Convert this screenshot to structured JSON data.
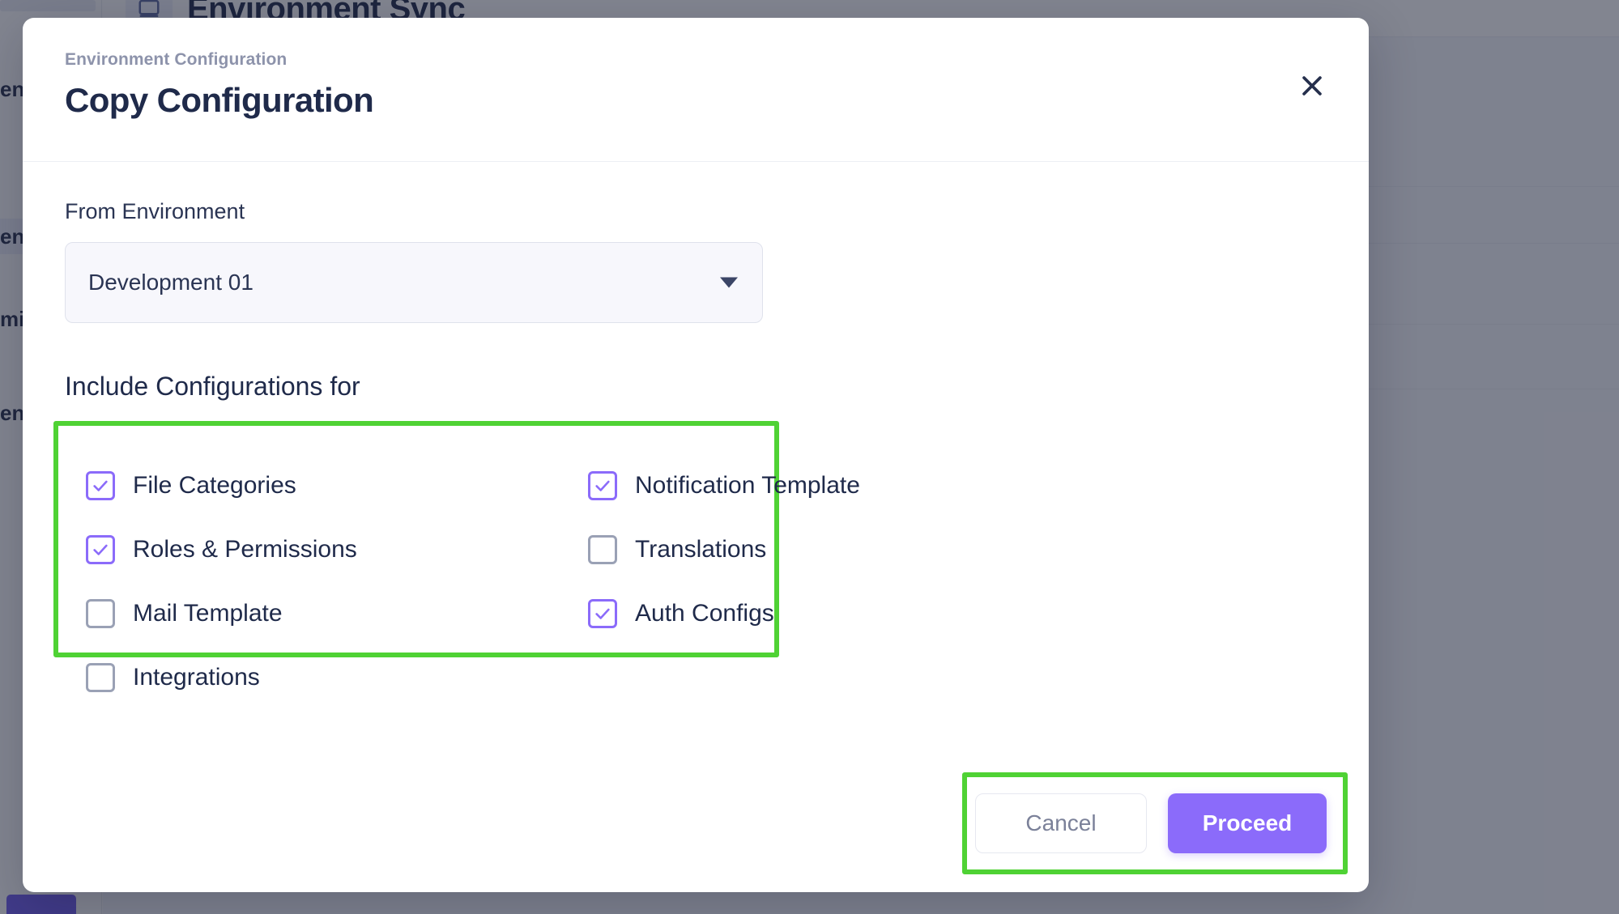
{
  "background": {
    "page_title": "Environment Sync",
    "sidebar_items": [
      {
        "label": "ent",
        "selected": false
      },
      {
        "label": "ent",
        "selected": true
      },
      {
        "label": "min",
        "selected": false
      },
      {
        "label": "ent",
        "selected": false
      }
    ]
  },
  "modal": {
    "eyebrow": "Environment Configuration",
    "title": "Copy Configuration",
    "close_icon": "close-icon",
    "from_environment": {
      "label": "From Environment",
      "value": "Development 01",
      "arrow_icon": "chevron-down-icon"
    },
    "include_section": {
      "title": "Include Configurations for",
      "options": [
        {
          "label": "File Categories",
          "checked": true,
          "column": "left"
        },
        {
          "label": "Roles & Permissions",
          "checked": true,
          "column": "left"
        },
        {
          "label": "Mail Template",
          "checked": false,
          "column": "left"
        },
        {
          "label": "Integrations",
          "checked": false,
          "column": "left"
        },
        {
          "label": "Notification Template",
          "checked": true,
          "column": "right"
        },
        {
          "label": "Translations",
          "checked": false,
          "column": "right"
        },
        {
          "label": "Auth Configs",
          "checked": true,
          "column": "right"
        }
      ]
    },
    "footer": {
      "cancel_label": "Cancel",
      "proceed_label": "Proceed"
    }
  },
  "colors": {
    "accent_purple": "#8b6bfa",
    "title_navy": "#1f2a4a",
    "muted_gray": "#8d93ab",
    "annotation_green": "#4fd234",
    "checkbox_unchecked": "#9aa1b5"
  }
}
